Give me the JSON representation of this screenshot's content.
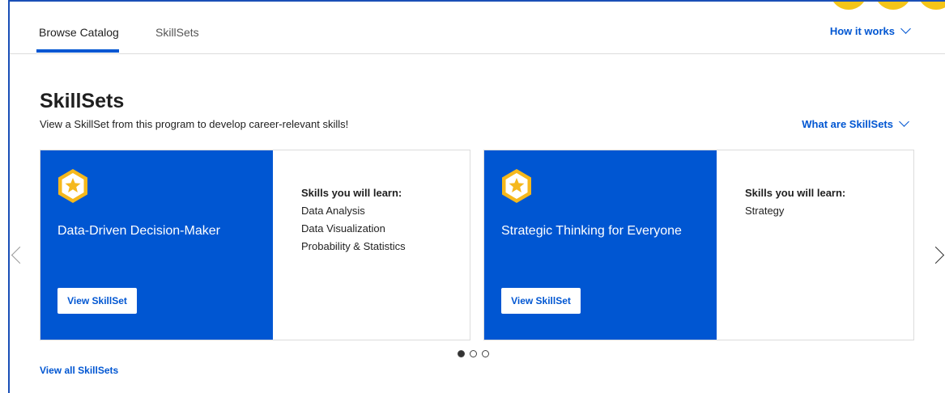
{
  "colors": {
    "accent": "#0056d2",
    "frame_border": "#1a4fb7",
    "badge_gold": "#f5c518",
    "text_primary": "#1f1f1f"
  },
  "topnav": {
    "tabs": [
      {
        "label": "Browse Catalog",
        "active": true
      },
      {
        "label": "SkillSets",
        "active": false
      }
    ],
    "how_it_works": "How it works",
    "how_it_works_icon": "chevron-down-icon"
  },
  "section": {
    "title": "SkillSets",
    "subtitle": "View a SkillSet from this program to develop career-relevant skills!",
    "what_are": "What are SkillSets",
    "what_are_icon": "chevron-down-icon"
  },
  "cards": [
    {
      "title": "Data-Driven Decision-Maker",
      "button_label": "View SkillSet",
      "badge_icon": "star-badge-icon",
      "skills_heading": "Skills you will learn:",
      "skills": [
        "Data Analysis",
        "Data Visualization",
        "Probability & Statistics"
      ]
    },
    {
      "title": "Strategic Thinking for Everyone",
      "button_label": "View SkillSet",
      "badge_icon": "star-badge-icon",
      "skills_heading": "Skills you will learn:",
      "skills": [
        "Strategy"
      ]
    }
  ],
  "carousel": {
    "prev_icon": "chevron-left-icon",
    "next_icon": "chevron-right-icon",
    "total_pages": 3,
    "current_page": 1
  },
  "footer": {
    "view_all": "View all SkillSets"
  }
}
